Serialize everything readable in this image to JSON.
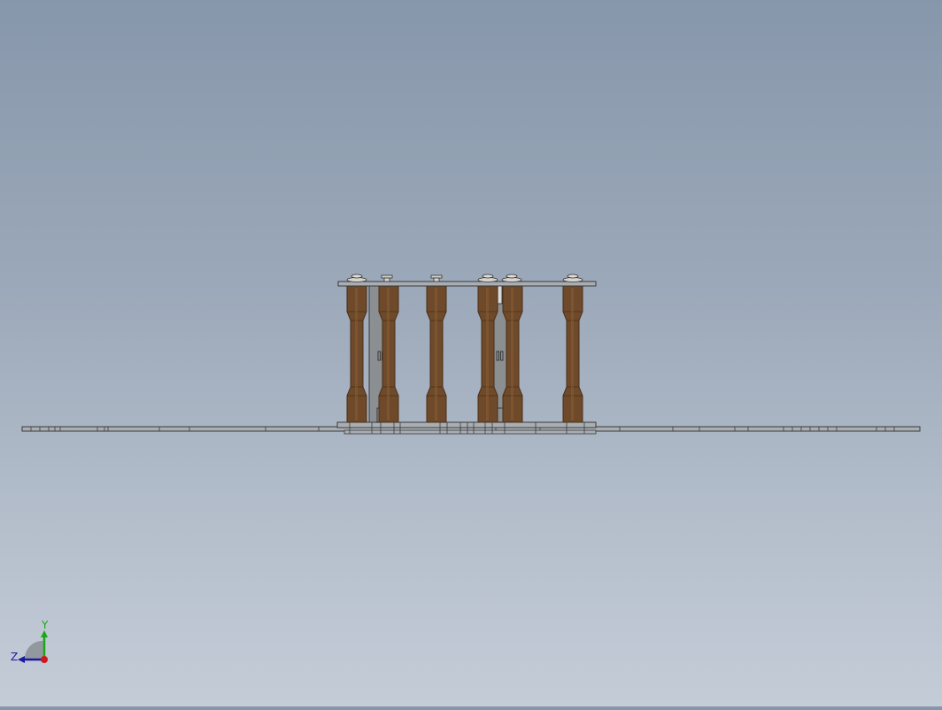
{
  "scene": {
    "description_hidden": "",
    "colors": {
      "background_top": "#8797ab",
      "background_bottom": "#c4ccd7",
      "plate": "#a9aeb3",
      "plate_edge": "#3a3a3a",
      "column": "#6e4a2a",
      "column_highlight": "#8a5e36",
      "column_shadow": "#4a2f18",
      "bracket": "#8c8f92",
      "axis_x": "#d01818",
      "axis_y": "#18a818",
      "axis_z": "#1a1aa0"
    },
    "columns_count": 6,
    "brackets_count": 2
  },
  "triad": {
    "y_label": "Y",
    "z_label": "Z",
    "icons": [
      "view-orientation-triad-icon"
    ]
  }
}
